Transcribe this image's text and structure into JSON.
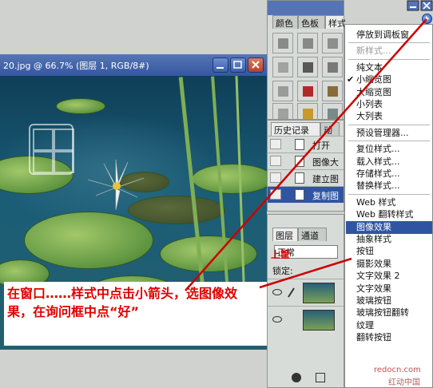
{
  "document": {
    "title": "20.jpg @ 66.7% (图层 1, RGB/8#)"
  },
  "annotation": {
    "text": "在窗口……样式中点击小箭头，选图像效果，在询问框中点“好”"
  },
  "styles_panel": {
    "tabs": [
      "颜色",
      "色板",
      "样式"
    ],
    "swatch_colors": [
      "#8a8a8a",
      "#888888",
      "#8e8e8e",
      "#a2a2a2",
      "#585858",
      "#7a7a7a",
      "#9a9a9a",
      "#b12a2a",
      "#8b6a3a",
      "#a0a0a0",
      "#c89a2a",
      "#7a8a8a"
    ]
  },
  "history_panel": {
    "tabs": [
      "历史记录",
      "动"
    ],
    "items": [
      "打开",
      "图像大",
      "建立图",
      "复制图"
    ]
  },
  "layers_panel": {
    "tabs": [
      "图层",
      "通道"
    ],
    "blend_mode": "正常",
    "lock_label": "锁定:",
    "red_mark": "上筐"
  },
  "style_menu": {
    "items": [
      {
        "label": "停放到调板窗",
        "state": "normal"
      },
      {
        "separator": true
      },
      {
        "label": "新样式...",
        "state": "disabled"
      },
      {
        "separator": true
      },
      {
        "label": "纯文本",
        "state": "normal"
      },
      {
        "label": "小缩览图",
        "state": "checked"
      },
      {
        "label": "大缩览图",
        "state": "normal"
      },
      {
        "label": "小列表",
        "state": "normal"
      },
      {
        "label": "大列表",
        "state": "normal"
      },
      {
        "separator": true
      },
      {
        "label": "预设管理器...",
        "state": "normal"
      },
      {
        "separator": true
      },
      {
        "label": "复位样式...",
        "state": "normal"
      },
      {
        "label": "载入样式...",
        "state": "normal"
      },
      {
        "label": "存储样式...",
        "state": "normal"
      },
      {
        "label": "替换样式...",
        "state": "normal"
      },
      {
        "separator": true
      },
      {
        "label": "Web 样式",
        "state": "normal"
      },
      {
        "label": "Web 翻转样式",
        "state": "normal"
      },
      {
        "label": "图像效果",
        "state": "highlighted"
      },
      {
        "label": "抽象样式",
        "state": "normal"
      },
      {
        "label": "按钮",
        "state": "normal"
      },
      {
        "label": "摄影效果",
        "state": "normal"
      },
      {
        "label": "文字效果 2",
        "state": "normal"
      },
      {
        "label": "文字效果",
        "state": "normal"
      },
      {
        "label": "玻璃按钮",
        "state": "normal"
      },
      {
        "label": "玻璃按钮翻转",
        "state": "normal"
      },
      {
        "label": "纹理",
        "state": "normal"
      },
      {
        "label": "翻转按钮",
        "state": "normal"
      }
    ]
  },
  "watermark": {
    "url": "redocn.com",
    "site": "红动中国"
  },
  "colors": {
    "highlight": "#2f55a2",
    "annotation_text": "#e00000",
    "arrow_line": "#cc0000"
  }
}
